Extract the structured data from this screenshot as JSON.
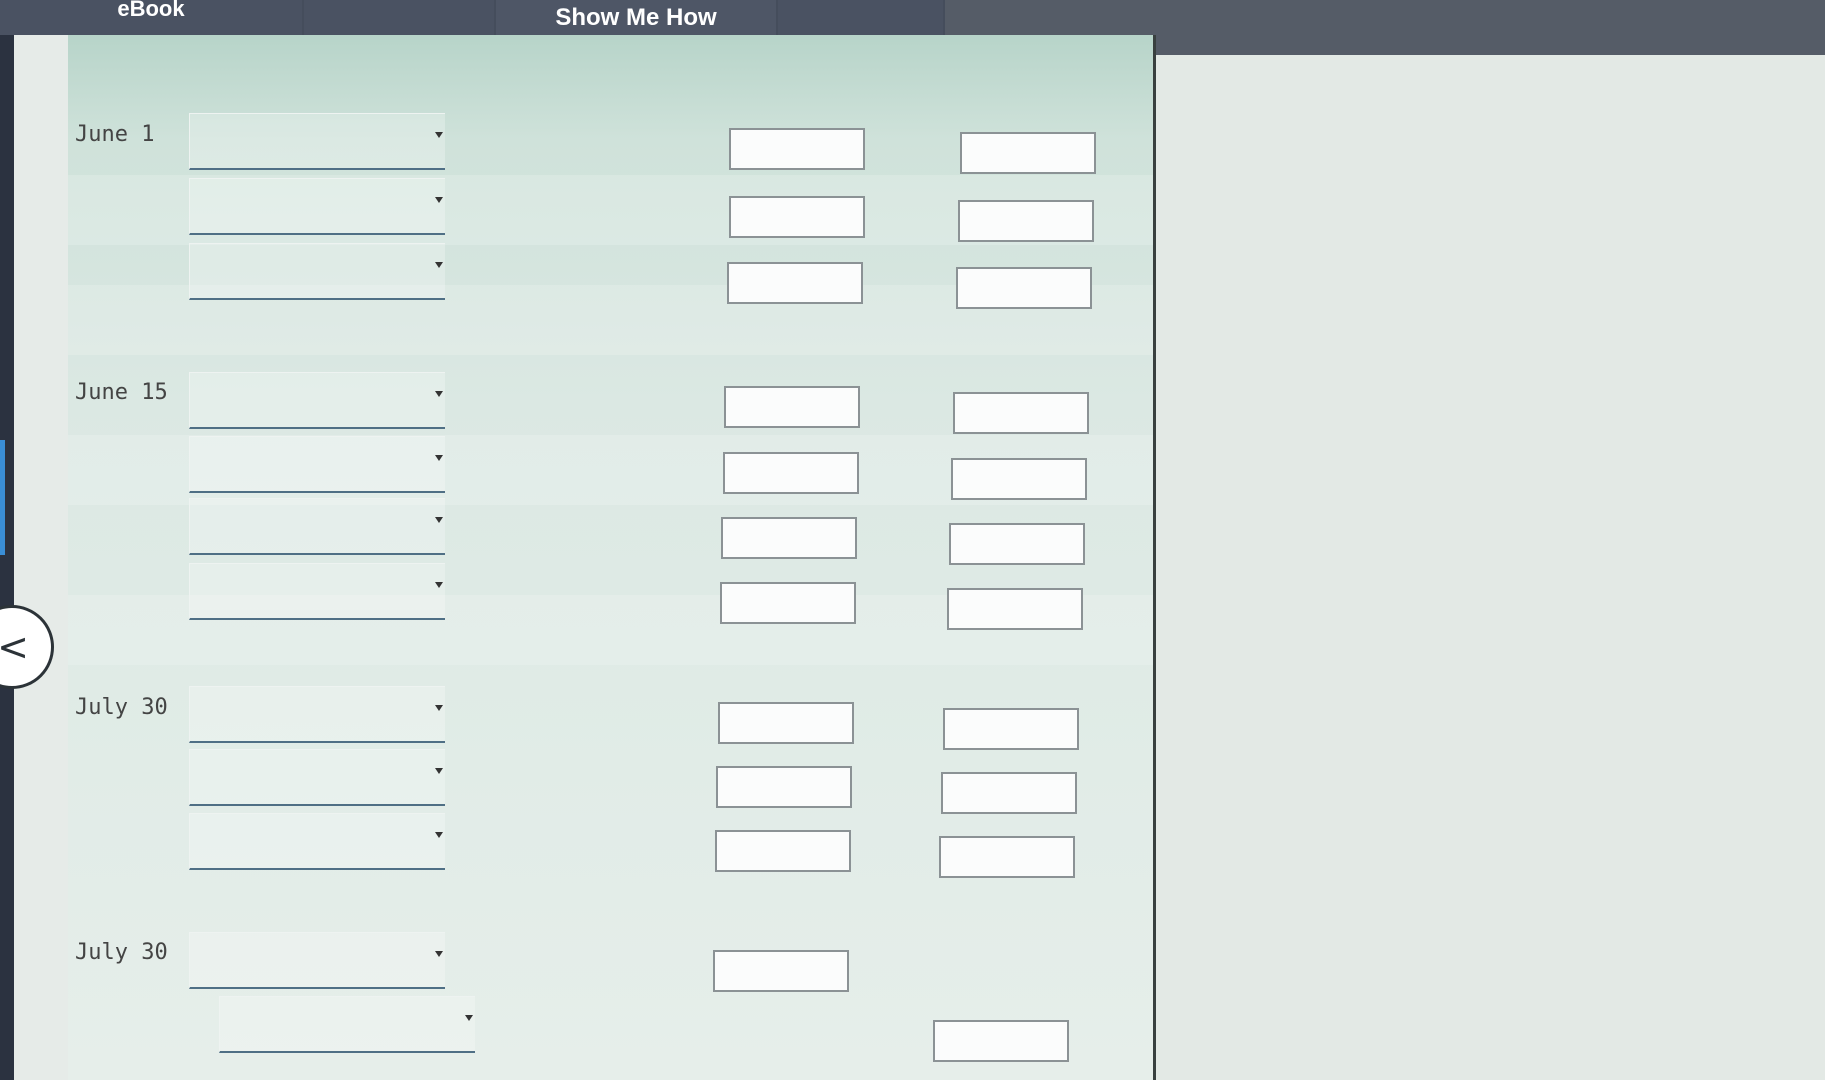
{
  "tabs": {
    "ebook": "eBook",
    "show_me_how": "Show Me How"
  },
  "entries": [
    {
      "date": "June 1",
      "rows": 3,
      "debit_boxes": 3,
      "credit_boxes": 3
    },
    {
      "date": "June 15",
      "rows": 4,
      "debit_boxes": 4,
      "credit_boxes": 4
    },
    {
      "date": "July 30",
      "rows": 3,
      "debit_boxes": 3,
      "credit_boxes": 3
    },
    {
      "date": "July 30",
      "rows": 2,
      "debit_boxes": 1,
      "credit_boxes": 1
    }
  ],
  "icons": {
    "back": "chevron-left-icon",
    "dropdown": "caret-down-icon"
  },
  "colors": {
    "toolbar": "#454d5c",
    "panel": "#dbe8e3",
    "field_underline": "#4f6f85"
  }
}
